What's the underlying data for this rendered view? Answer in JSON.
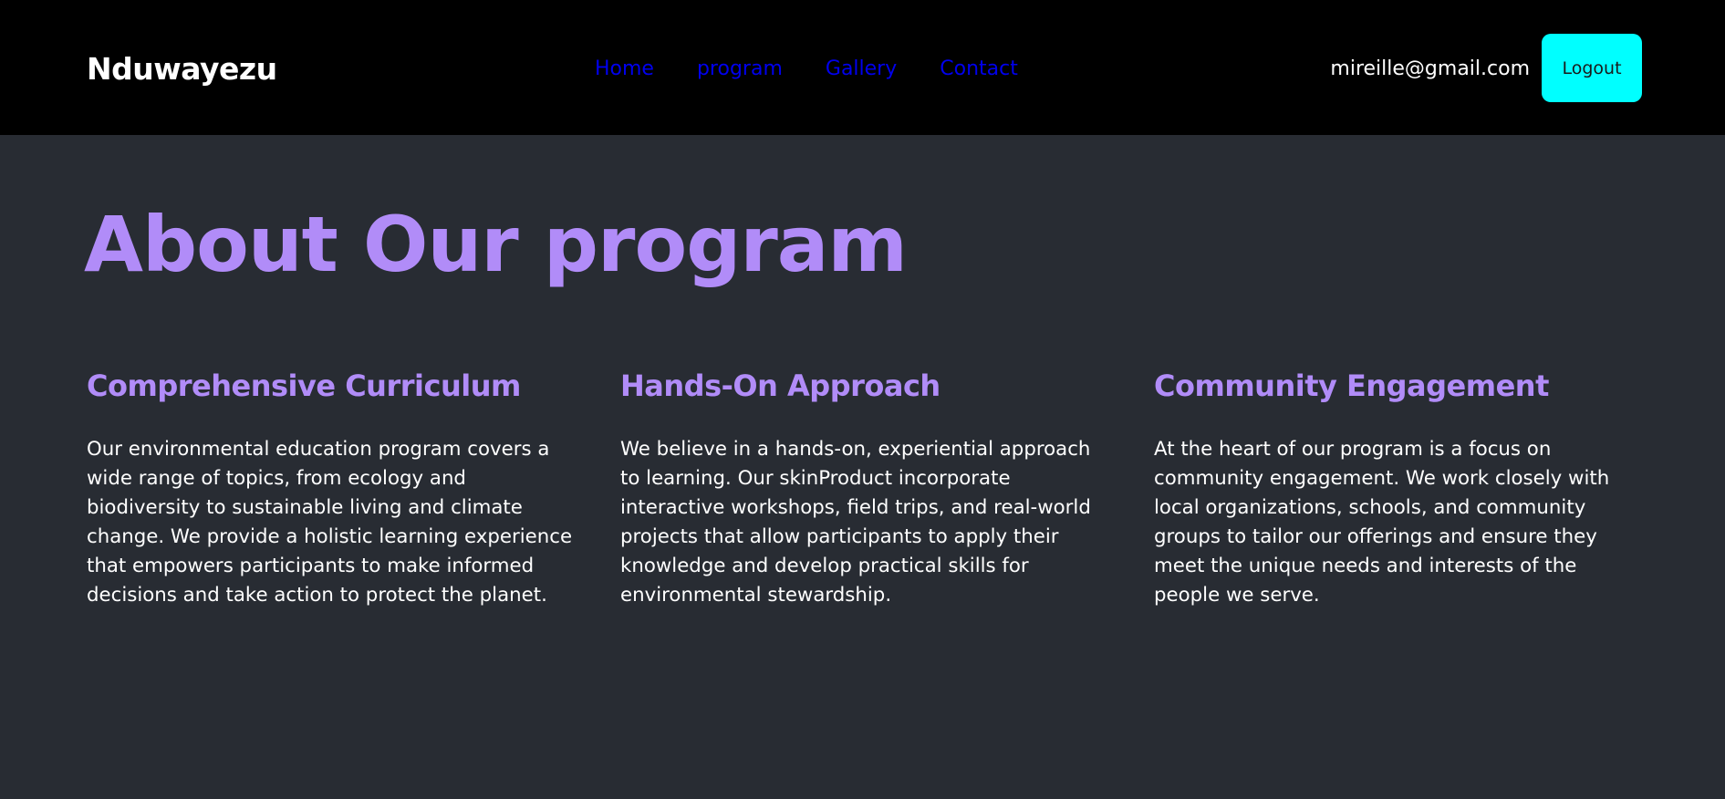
{
  "header": {
    "brand": "Nduwayezu",
    "nav": [
      {
        "label": "Home"
      },
      {
        "label": "program"
      },
      {
        "label": "Gallery"
      },
      {
        "label": "Contact"
      }
    ],
    "user_email": "mireille@gmail.com",
    "logout_label": "Logout"
  },
  "main": {
    "title": "About Our program",
    "sections": [
      {
        "heading": "Comprehensive Curriculum",
        "body": "Our environmental education program covers a wide range of topics, from ecology and biodiversity to sustainable living and climate change. We provide a holistic learning experience that empowers participants to make informed decisions and take action to protect the planet."
      },
      {
        "heading": "Hands-On Approach",
        "body": "We believe in a hands-on, experiential approach to learning. Our skinProduct incorporate interactive workshops, field trips, and real-world projects that allow participants to apply their knowledge and develop practical skills for environmental stewardship."
      },
      {
        "heading": "Community Engagement",
        "body": "At the heart of our program is a focus on community engagement. We work closely with local organizations, schools, and community groups to tailor our offerings and ensure they meet the unique needs and interests of the people we serve."
      }
    ]
  },
  "colors": {
    "header_bg": "#000000",
    "page_bg": "#282c33",
    "accent": "#b18cf8",
    "link": "#0000ee",
    "logout_bg": "#00ffff"
  }
}
